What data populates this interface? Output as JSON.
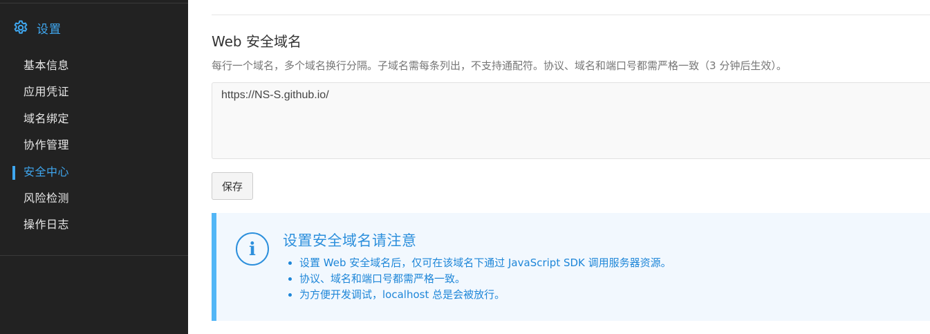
{
  "sidebar": {
    "section_icon": "gear-icon",
    "section_title": "设置",
    "items": [
      {
        "label": "基本信息"
      },
      {
        "label": "应用凭证"
      },
      {
        "label": "域名绑定"
      },
      {
        "label": "协作管理"
      },
      {
        "label": "安全中心"
      },
      {
        "label": "风险检测"
      },
      {
        "label": "操作日志"
      }
    ],
    "active_item": "安全中心"
  },
  "main": {
    "heading": "Web 安全域名",
    "description": "每行一个域名，多个域名换行分隔。子域名需每条列出，不支持通配符。协议、域名和端口号都需严格一致（3 分钟后生效）。",
    "domains_value": "https://NS-S.github.io/",
    "save_label": "保存"
  },
  "notice": {
    "icon": "info-icon",
    "title": "设置安全域名请注意",
    "items": [
      "设置 Web 安全域名后，仅可在该域名下通过 JavaScript SDK 调用服务器资源。",
      "协议、域名和端口号都需严格一致。",
      "为方便开发调试，localhost 总是会被放行。"
    ]
  },
  "colors": {
    "sidebar_bg": "#222222",
    "accent": "#3fa7f0",
    "notice_bg": "#f2f8fe",
    "notice_bar": "#52b6f6",
    "notice_text": "#1e86d8"
  }
}
